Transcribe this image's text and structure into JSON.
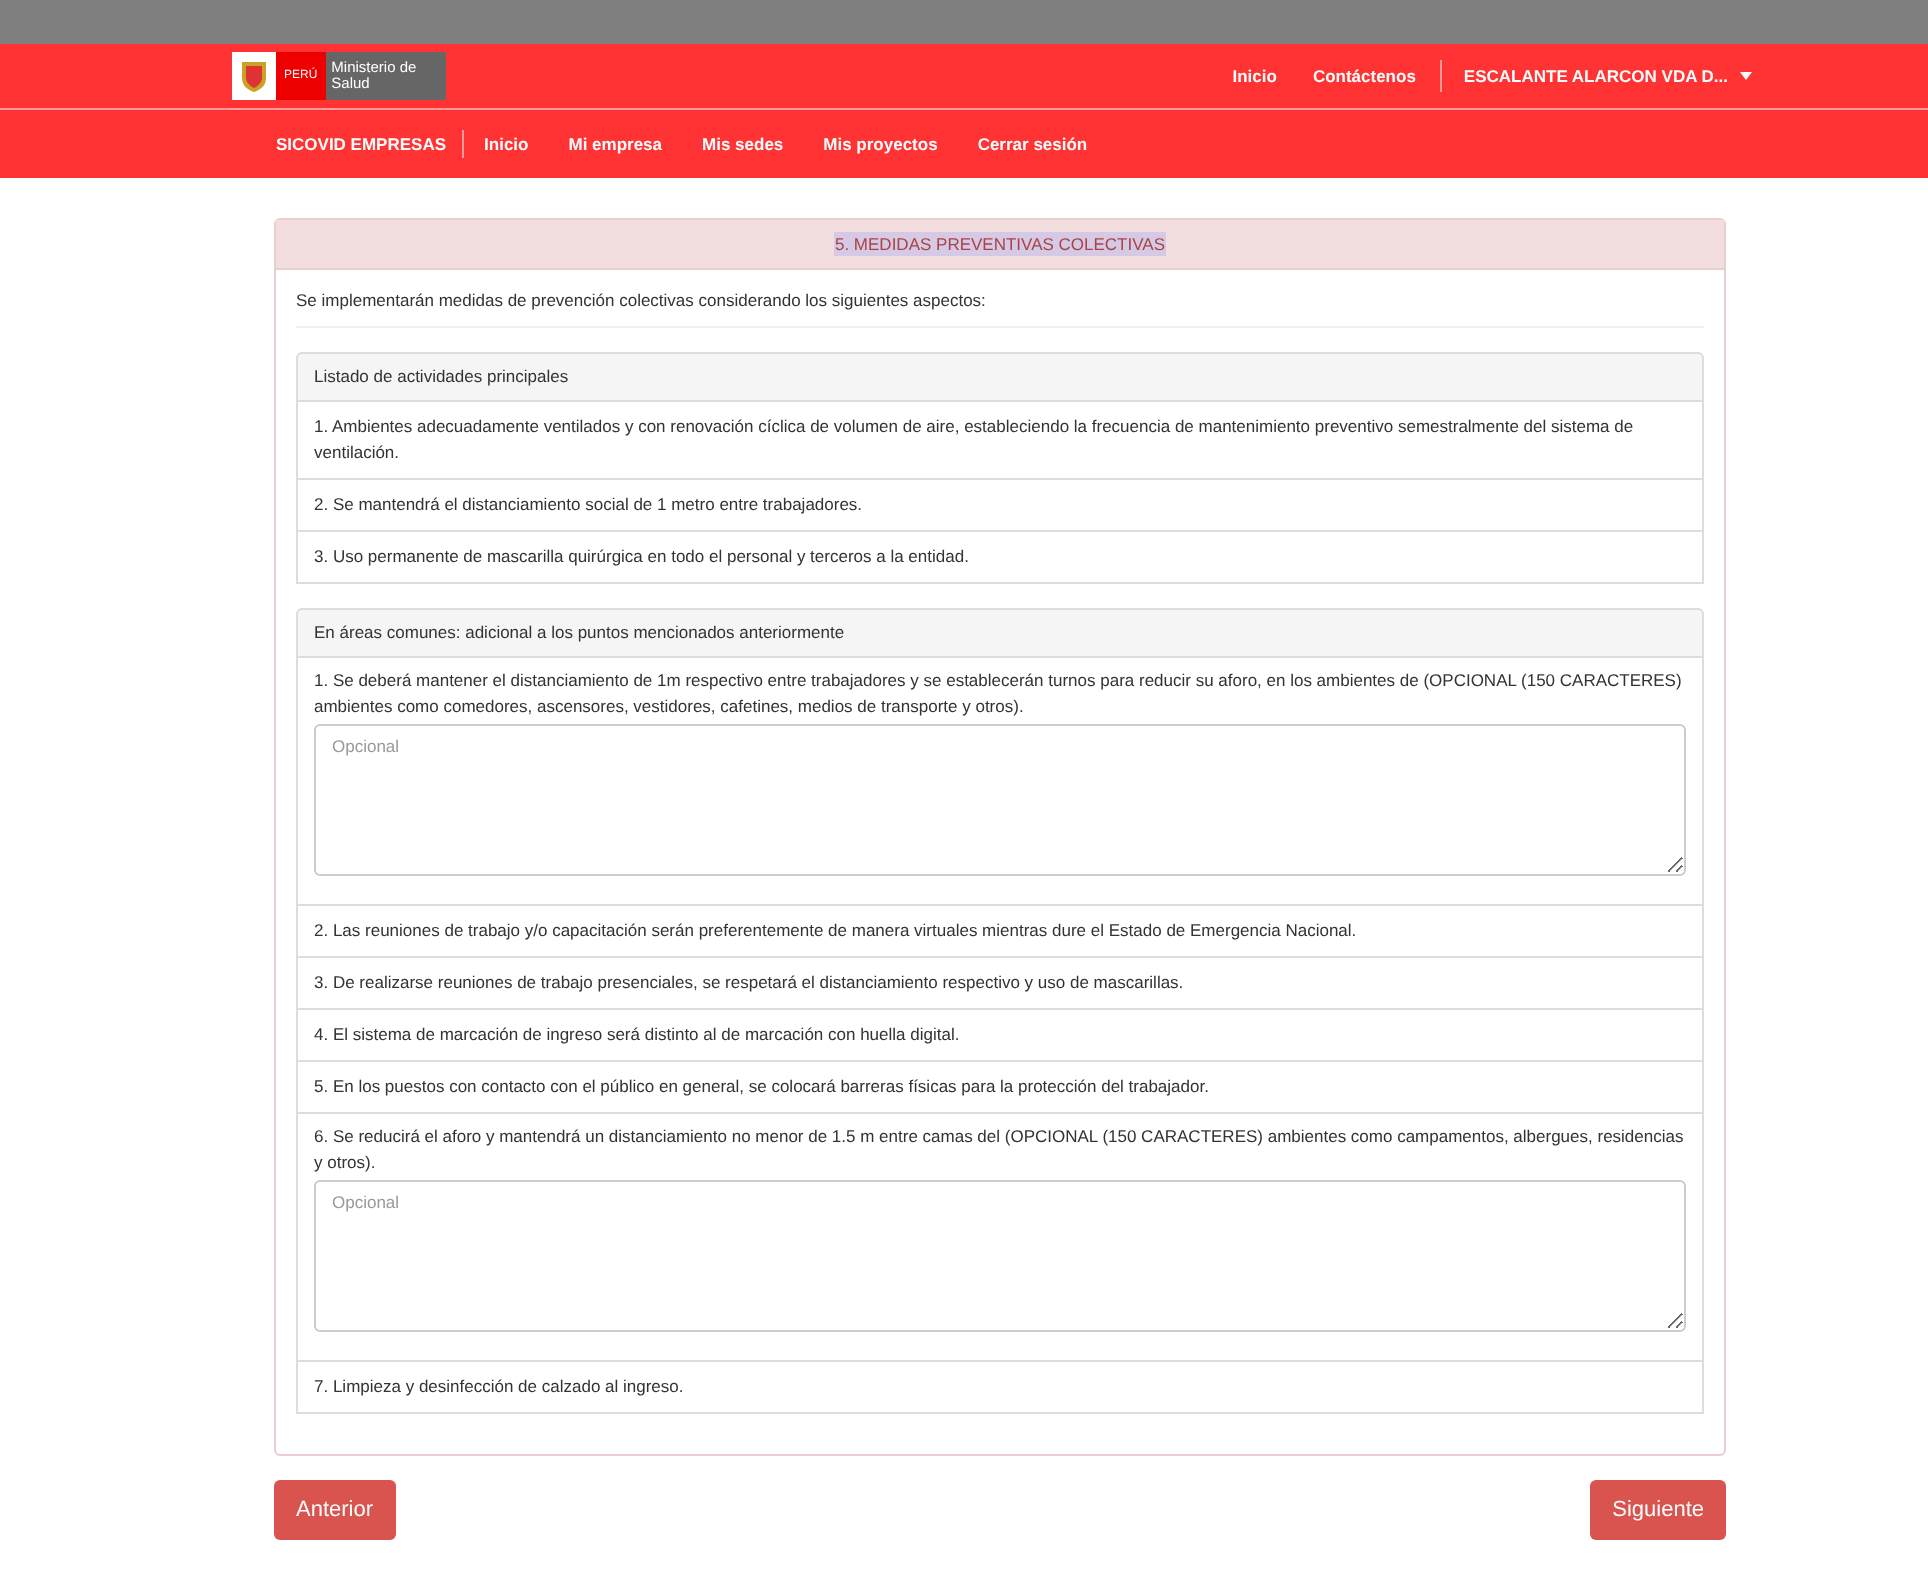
{
  "header": {
    "logo": {
      "country": "PERÚ",
      "ministry": "Ministerio de Salud"
    },
    "links": [
      "Inicio",
      "Contáctenos"
    ],
    "user": "ESCALANTE ALARCON VDA D..."
  },
  "nav": {
    "brand": "SICOVID EMPRESAS",
    "items": [
      "Inicio",
      "Mi empresa",
      "Mis sedes",
      "Mis proyectos",
      "Cerrar sesión"
    ]
  },
  "section": {
    "title": "5. MEDIDAS PREVENTIVAS COLECTIVAS",
    "title_highlighted": true,
    "intro": "Se implementarán medidas de prevención colectivas considerando los siguientes aspectos:",
    "groups": [
      {
        "heading": "Listado de actividades principales",
        "items": [
          {
            "kind": "text",
            "text": "1. Ambientes adecuadamente ventilados y con renovación cíclica de volumen de aire, estableciendo la frecuencia de mantenimiento preventivo semestralmente del sistema de ventilación."
          },
          {
            "kind": "text",
            "text": "2. Se mantendrá el distanciamiento social de 1 metro entre trabajadores."
          },
          {
            "kind": "text",
            "text": "3. Uso permanente de mascarilla quirúrgica en todo el personal y terceros a la entidad."
          }
        ]
      },
      {
        "heading": "En áreas comunes: adicional a los puntos mencionados anteriormente",
        "items": [
          {
            "kind": "field",
            "text": "1. Se deberá mantener el distanciamiento de 1m respectivo entre trabajadores y se establecerán turnos para reducir su aforo, en los ambientes de (OPCIONAL (150 CARACTERES) ambientes como comedores, ascensores, vestidores, cafetines, medios de transporte y otros).",
            "placeholder": "Opcional"
          },
          {
            "kind": "text",
            "text": "2. Las reuniones de trabajo y/o capacitación serán preferentemente de manera virtuales mientras dure el Estado de Emergencia Nacional."
          },
          {
            "kind": "text",
            "text": "3. De realizarse reuniones de trabajo presenciales, se respetará el distanciamiento respectivo y uso de mascarillas."
          },
          {
            "kind": "text",
            "text": "4. El sistema de marcación de ingreso será distinto al de marcación con huella digital."
          },
          {
            "kind": "text",
            "text": "5. En los puestos con contacto con el público en general, se colocará barreras físicas para la protección del trabajador."
          },
          {
            "kind": "field",
            "text": "6. Se reducirá el aforo y mantendrá un distanciamiento no menor de 1.5 m entre camas del (OPCIONAL (150 CARACTERES) ambientes como campamentos, albergues, residencias y otros).",
            "placeholder": "Opcional"
          },
          {
            "kind": "text",
            "text": "7. Limpieza y desinfección de calzado al ingreso."
          }
        ]
      }
    ]
  },
  "buttons": {
    "back": "Anterior",
    "next": "Siguiente"
  }
}
